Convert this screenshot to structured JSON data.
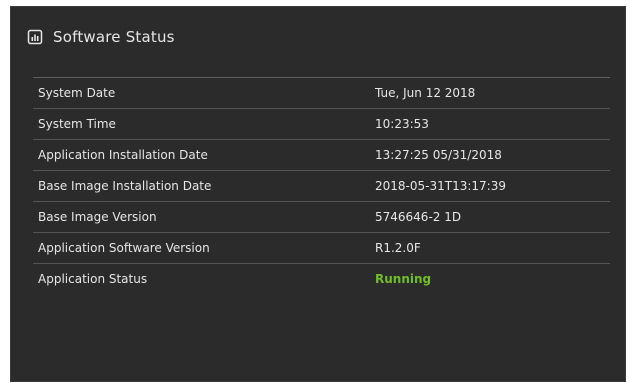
{
  "header": {
    "title": "Software Status",
    "icon": "report-chart-icon"
  },
  "rows": [
    {
      "label": "System Date",
      "value": "Tue, Jun 12 2018"
    },
    {
      "label": "System Time",
      "value": "10:23:53"
    },
    {
      "label": "Application Installation Date",
      "value": "13:27:25 05/31/2018"
    },
    {
      "label": "Base Image Installation Date",
      "value": "2018-05-31T13:17:39"
    },
    {
      "label": "Base Image Version",
      "value": "5746646-2 1D"
    },
    {
      "label": "Application Software Version",
      "value": "R1.2.0F"
    },
    {
      "label": "Application Status",
      "value": "Running"
    }
  ],
  "colors": {
    "panel_background": "#2b2b2b",
    "text": "#e6e6e6",
    "divider": "#565656",
    "status_running": "#6fbe2a"
  }
}
